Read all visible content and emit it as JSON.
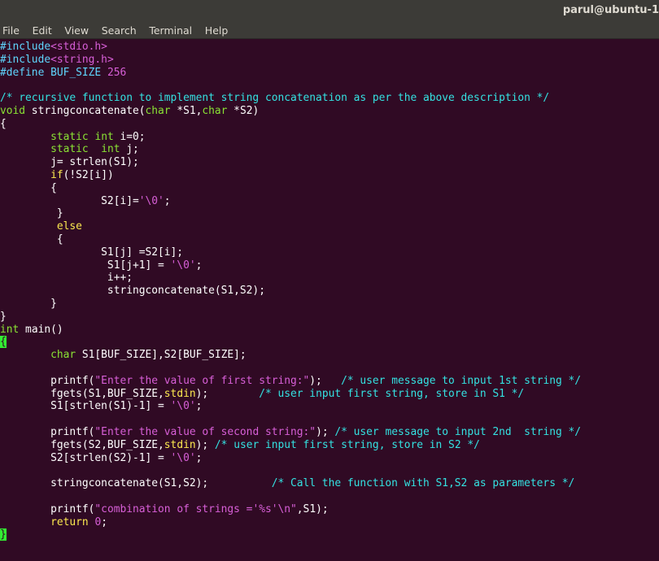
{
  "window": {
    "title": "parul@ubuntu-1"
  },
  "menu": [
    "File",
    "Edit",
    "View",
    "Search",
    "Terminal",
    "Help"
  ],
  "code": [
    [
      [
        "pp",
        "#include"
      ],
      [
        "inc",
        "<stdio.h>"
      ]
    ],
    [
      [
        "pp",
        "#include"
      ],
      [
        "inc",
        "<string.h>"
      ]
    ],
    [
      [
        "pp",
        "#define BUF_SIZE "
      ],
      [
        "nm",
        "256"
      ]
    ],
    [],
    [
      [
        "cm",
        "/* recursive function to implement string concatenation as per the above description */"
      ]
    ],
    [
      [
        "ty",
        "void"
      ],
      [
        "plain",
        " stringconcatenate("
      ],
      [
        "ty",
        "char"
      ],
      [
        "plain",
        " *S1,"
      ],
      [
        "ty",
        "char"
      ],
      [
        "plain",
        " *S2)"
      ]
    ],
    [
      [
        "plain",
        "{"
      ]
    ],
    [
      [
        "plain",
        "        "
      ],
      [
        "ty",
        "static"
      ],
      [
        "plain",
        " "
      ],
      [
        "ty",
        "int"
      ],
      [
        "plain",
        " i=0;"
      ]
    ],
    [
      [
        "plain",
        "        "
      ],
      [
        "ty",
        "static"
      ],
      [
        "plain",
        "  "
      ],
      [
        "ty",
        "int"
      ],
      [
        "plain",
        " j;"
      ]
    ],
    [
      [
        "plain",
        "        j= strlen(S1);"
      ]
    ],
    [
      [
        "plain",
        "        "
      ],
      [
        "kw",
        "if"
      ],
      [
        "plain",
        "(!S2[i])"
      ]
    ],
    [
      [
        "plain",
        "        {"
      ]
    ],
    [
      [
        "plain",
        "                S2[i]="
      ],
      [
        "st",
        "'\\0'"
      ],
      [
        "plain",
        ";"
      ]
    ],
    [
      [
        "plain",
        "         }"
      ]
    ],
    [
      [
        "plain",
        "         "
      ],
      [
        "kw",
        "else"
      ]
    ],
    [
      [
        "plain",
        "         {"
      ]
    ],
    [
      [
        "plain",
        "                S1[j] =S2[i];"
      ]
    ],
    [
      [
        "plain",
        "                 S1[j+1] = "
      ],
      [
        "st",
        "'\\0'"
      ],
      [
        "plain",
        ";"
      ]
    ],
    [
      [
        "plain",
        "                 i++;"
      ]
    ],
    [
      [
        "plain",
        "                 stringconcatenate(S1,S2);"
      ]
    ],
    [
      [
        "plain",
        "        }"
      ]
    ],
    [
      [
        "plain",
        "}"
      ]
    ],
    [
      [
        "ty",
        "int"
      ],
      [
        "plain",
        " main()"
      ]
    ],
    [
      [
        "cursor",
        "{"
      ]
    ],
    [
      [
        "plain",
        "        "
      ],
      [
        "ty",
        "char"
      ],
      [
        "plain",
        " S1[BUF_SIZE],S2[BUF_SIZE];"
      ]
    ],
    [],
    [
      [
        "plain",
        "        printf("
      ],
      [
        "st",
        "\"Enter the value of first string:\""
      ],
      [
        "plain",
        ");   "
      ],
      [
        "cm",
        "/* user message to input 1st string */"
      ]
    ],
    [
      [
        "plain",
        "        fgets(S1,BUF_SIZE,"
      ],
      [
        "kw",
        "stdin"
      ],
      [
        "plain",
        ");        "
      ],
      [
        "cm",
        "/* user input first string, store in S1 */"
      ]
    ],
    [
      [
        "plain",
        "        S1[strlen(S1)-1] = "
      ],
      [
        "st",
        "'\\0'"
      ],
      [
        "plain",
        ";"
      ]
    ],
    [],
    [
      [
        "plain",
        "        printf("
      ],
      [
        "st",
        "\"Enter the value of second string:\""
      ],
      [
        "plain",
        "); "
      ],
      [
        "cm",
        "/* user message to input 2nd  string */"
      ]
    ],
    [
      [
        "plain",
        "        fgets(S2,BUF_SIZE,"
      ],
      [
        "kw",
        "stdin"
      ],
      [
        "plain",
        "); "
      ],
      [
        "cm",
        "/* user input first string, store in S2 */"
      ]
    ],
    [
      [
        "plain",
        "        S2[strlen(S2)-1] = "
      ],
      [
        "st",
        "'\\0'"
      ],
      [
        "plain",
        ";"
      ]
    ],
    [],
    [
      [
        "plain",
        "        stringconcatenate(S1,S2);          "
      ],
      [
        "cm",
        "/* Call the function with S1,S2 as parameters */"
      ]
    ],
    [],
    [
      [
        "plain",
        "        printf("
      ],
      [
        "st",
        "\"combination of strings ='"
      ],
      [
        "inc",
        "%s"
      ],
      [
        "st",
        "'\\n\""
      ],
      [
        "plain",
        ",S1);"
      ]
    ],
    [
      [
        "plain",
        "        "
      ],
      [
        "kw",
        "return"
      ],
      [
        "plain",
        " "
      ],
      [
        "nm",
        "0"
      ],
      [
        "plain",
        ";"
      ]
    ],
    [
      [
        "cursor",
        "}"
      ]
    ]
  ]
}
